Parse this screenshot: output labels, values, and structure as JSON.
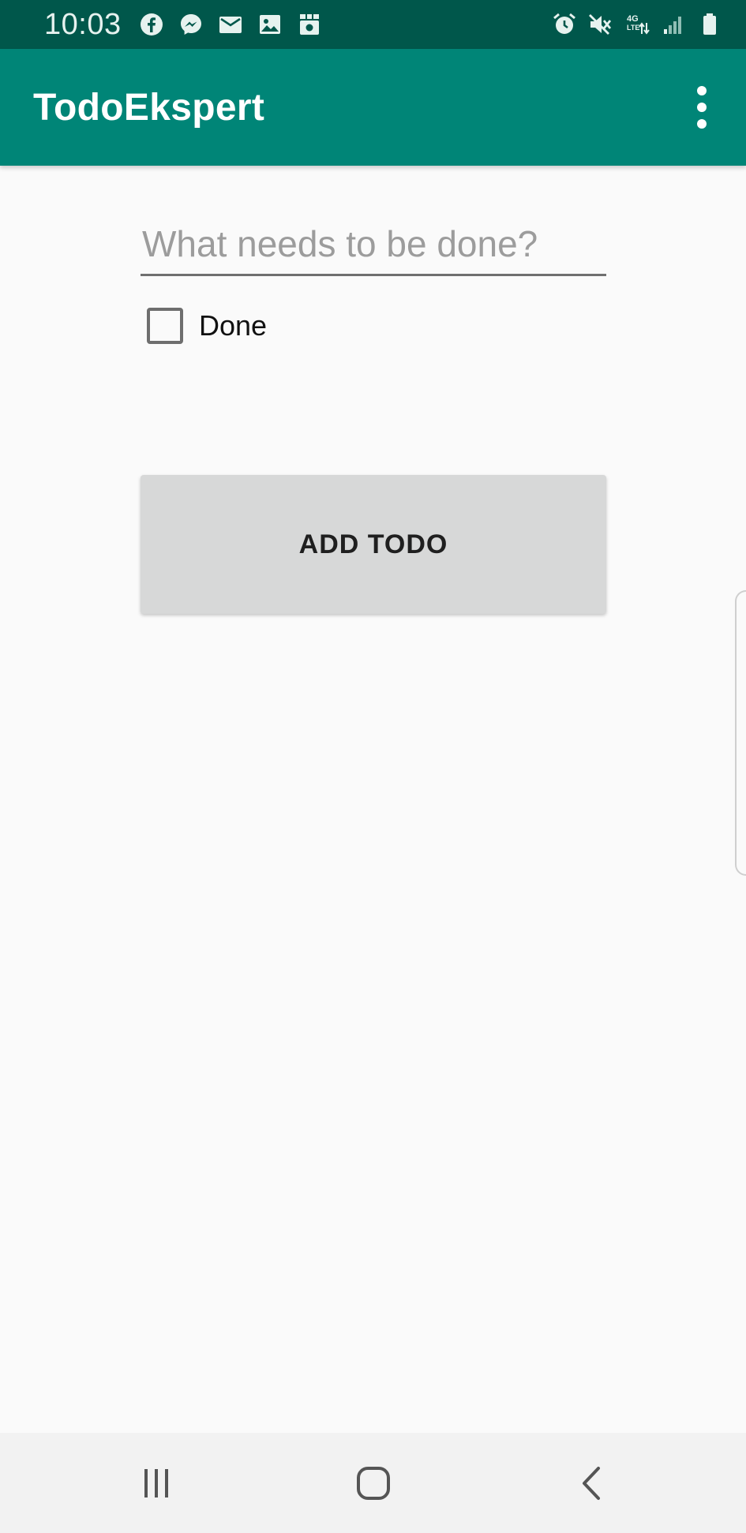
{
  "status_bar": {
    "time": "10:03",
    "left_icons": [
      "facebook-icon",
      "messenger-icon",
      "mail-icon",
      "image-icon",
      "screenshot-icon"
    ],
    "right_icons": [
      "alarm-icon",
      "mute-icon",
      "network-4g-lte-icon",
      "signal-icon",
      "battery-icon"
    ]
  },
  "app_bar": {
    "title": "TodoEkspert",
    "overflow_icon": "more-vertical-icon"
  },
  "form": {
    "input_placeholder": "What needs to be done?",
    "input_value": "",
    "checkbox_label": "Done",
    "checkbox_checked": false,
    "add_button_label": "ADD TODO"
  },
  "nav_bar": {
    "buttons": [
      "recent-apps-icon",
      "home-icon",
      "back-icon"
    ]
  },
  "colors": {
    "status_bar": "#00574b",
    "app_bar": "#008577",
    "background": "#fafafa",
    "button": "#d7d8d8",
    "nav_bar": "#f2f2f2"
  }
}
